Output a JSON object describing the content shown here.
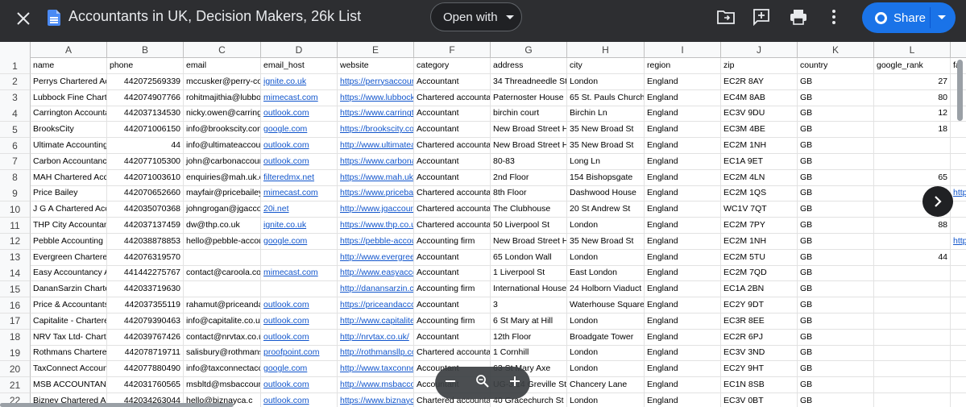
{
  "title": "Accountants in UK, Decision Makers, 26k List",
  "toolbar": {
    "open_with_label": "Open with",
    "share_label": "Share",
    "icons": [
      "close-icon",
      "docs-icon",
      "add-to-drive-icon",
      "add-comment-icon",
      "print-icon",
      "more-vert-icon",
      "globe-icon"
    ]
  },
  "colors": {
    "topbar": "#2d2e31",
    "share": "#1a73e8",
    "link": "#1155cc"
  },
  "column_letters": [
    "A",
    "B",
    "C",
    "D",
    "E",
    "F",
    "G",
    "H",
    "I",
    "J",
    "K",
    "L"
  ],
  "headers": [
    "name",
    "phone",
    "email",
    "email_host",
    "website",
    "category",
    "address",
    "city",
    "region",
    "zip",
    "country",
    "google_rank",
    "fa"
  ],
  "rows": [
    [
      "Perrys Chartered Acc",
      "442072569339",
      "mccusker@perry-con",
      "ignite.co.uk",
      "https://perrysaccount",
      "Accountant",
      "34 Threadneedle St",
      "London",
      "England",
      "EC2R 8AY",
      "GB",
      "27",
      ""
    ],
    [
      "Lubbock Fine Charte",
      "442074907766",
      "rohitmajithia@lubbo",
      "mimecast.com",
      "https://www.lubbockf",
      "Chartered accountan",
      "Paternoster House",
      "65 St. Pauls Churchy",
      "England",
      "EC4M 8AB",
      "GB",
      "80",
      ""
    ],
    [
      "Carrington Accounta",
      "442037134530",
      "nicky.owen@carring",
      "outlook.com",
      "https://www.carringto",
      "Accountant",
      "birchin court",
      "Birchin Ln",
      "England",
      "EC3V 9DU",
      "GB",
      "12",
      ""
    ],
    [
      "BrooksCity",
      "442071006150",
      "info@brookscity.com",
      "google.com",
      "https://brookscity.com",
      "Accountant",
      "New Broad Street Ho",
      "35 New Broad St",
      "England",
      "EC3M 4BE",
      "GB",
      "18",
      ""
    ],
    [
      "Ultimate Accounting",
      "44",
      "info@ultimateaccou",
      "outlook.com",
      "http://www.ultimatea",
      "Chartered accountan",
      "New Broad Street Ho",
      "35 New Broad St",
      "England",
      "EC2M 1NH",
      "GB",
      "",
      ""
    ],
    [
      "Carbon Accountancy",
      "442077105300",
      "john@carbonaccour",
      "outlook.com",
      "https://www.carbona",
      "Accountant",
      "80-83",
      "Long Ln",
      "England",
      "EC1A 9ET",
      "GB",
      "",
      ""
    ],
    [
      "MAH Chartered Acco",
      "442071003610",
      "enquiries@mah.uk.c",
      "filteredmx.net",
      "https://www.mah.uk.c",
      "Accountant",
      "2nd Floor",
      "154 Bishopsgate",
      "England",
      "EC2M 4LN",
      "GB",
      "65",
      ""
    ],
    [
      "Price Bailey",
      "442070652660",
      "mayfair@pricebailey",
      "mimecast.com",
      "https://www.pricebail",
      "Chartered accountan",
      "8th Floor",
      "Dashwood House",
      "England",
      "EC2M 1QS",
      "GB",
      "",
      "http"
    ],
    [
      "J G A Chartered Acc",
      "442035070368",
      "johngrogan@jgacco",
      "20i.net",
      "http://www.jgaccoun",
      "Chartered accountan",
      "The Clubhouse",
      "20 St Andrew St",
      "England",
      "WC1V 7QT",
      "GB",
      "",
      ""
    ],
    [
      "THP City Accountan",
      "442037137459",
      "dw@thp.co.uk",
      "ignite.co.uk",
      "https://www.thp.co.uk",
      "Chartered accountan",
      "50 Liverpool St",
      "London",
      "England",
      "EC2M 7PY",
      "GB",
      "88",
      ""
    ],
    [
      "Pebble Accounting",
      "442038878853",
      "hello@pebble-accou",
      "google.com",
      "https://pebble-accou",
      "Accounting firm",
      "New Broad Street Ho",
      "35 New Broad St",
      "England",
      "EC2M 1NH",
      "GB",
      "",
      "http"
    ],
    [
      "Evergreen Chartered",
      "442076319570",
      "",
      "",
      "http://www.evergreen",
      "Accountant",
      "65 London Wall",
      "London",
      "England",
      "EC2M 5TU",
      "GB",
      "44",
      ""
    ],
    [
      "Easy Accountancy A",
      "441442275767",
      "contact@caroola.co",
      "mimecast.com",
      "http://www.easyacco",
      "Accountant",
      "1 Liverpool St",
      "East London",
      "England",
      "EC2M 7QD",
      "GB",
      "",
      ""
    ],
    [
      "DananSarzin Charte",
      "442033719630",
      "",
      "",
      "http://danansarzin.co",
      "Accounting firm",
      "International House",
      "24 Holborn Viaduct",
      "England",
      "EC1A 2BN",
      "GB",
      "",
      ""
    ],
    [
      "Price & Accountants",
      "442037355119",
      "rahamut@priceanda",
      "outlook.com",
      "https://priceandacco",
      "Accountant",
      "3",
      "Waterhouse Square",
      "England",
      "EC2Y 9DT",
      "GB",
      "",
      ""
    ],
    [
      "Capitalite - Chartere",
      "442079390463",
      "info@capitalite.co.u",
      "outlook.com",
      "http://www.capitalite",
      "Accounting firm",
      "6 St Mary at Hill",
      "London",
      "England",
      "EC3R 8EE",
      "GB",
      "",
      ""
    ],
    [
      "NRV Tax Ltd- Charte",
      "442039767426",
      "contact@nrvtax.co.u",
      "outlook.com",
      "http://nrvtax.co.uk/",
      "Accountant",
      "12th Floor",
      "Broadgate Tower",
      "England",
      "EC2R 6PJ",
      "GB",
      "",
      ""
    ],
    [
      "Rothmans Chartered",
      "442078719711",
      "salisbury@rothmansl",
      "proofpoint.com",
      "http://rothmansllp.co",
      "Chartered accountan",
      "1 Cornhill",
      "London",
      "England",
      "EC3V 3ND",
      "GB",
      "",
      ""
    ],
    [
      "TaxConnect Accoun",
      "442077880490",
      "info@taxconnectacc",
      "google.com",
      "http://www.taxconne",
      "Accountant",
      "63 St Mary Axe",
      "London",
      "England",
      "EC2Y 9HT",
      "GB",
      "",
      ""
    ],
    [
      "MSB ACCOUNTANT",
      "442031760565",
      "msbltd@msbaccoun",
      "outlook.com",
      "http://www.msbaccou",
      "Accountant",
      "UG-3 14 Greville Stre",
      "Chancery Lane",
      "England",
      "EC1N 8SB",
      "GB",
      "",
      ""
    ],
    [
      "Bizney Chartered Ac",
      "442034263044",
      "hello@biznayca.c",
      "outlook.com",
      "https://www.biznayca",
      "Chartered accountan",
      "40 Gracechurch St",
      "London",
      "England",
      "EC3V 0BT",
      "GB",
      "",
      ""
    ]
  ]
}
